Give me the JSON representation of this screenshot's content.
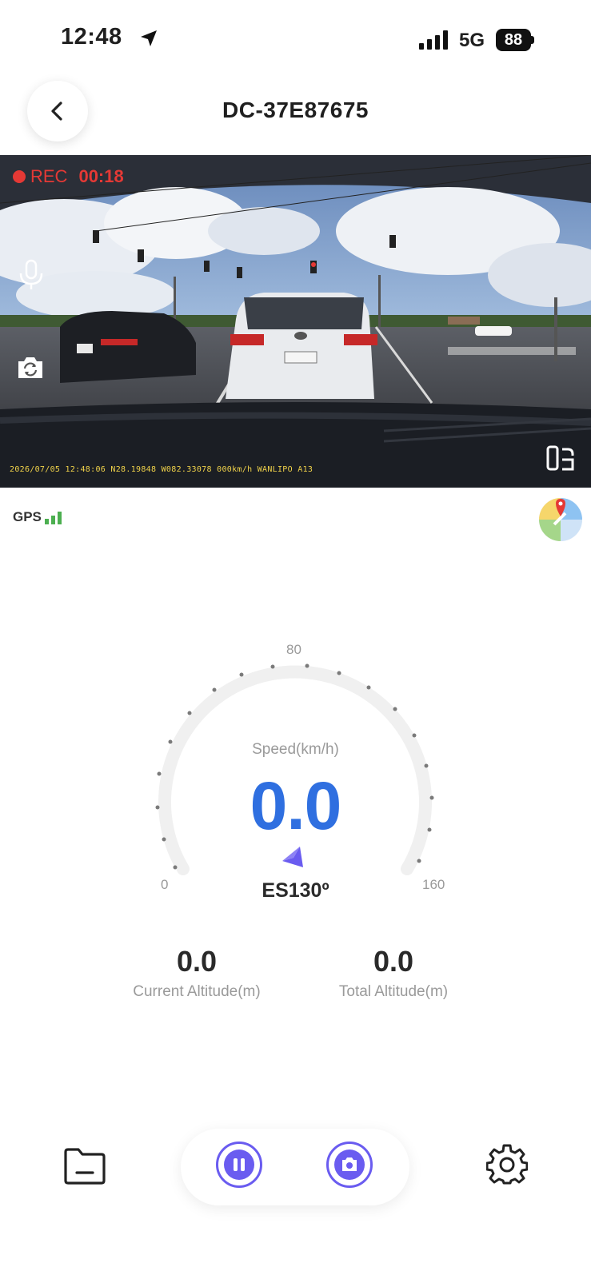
{
  "status_bar": {
    "time": "12:48",
    "network": "5G",
    "battery": "88"
  },
  "header": {
    "title": "DC-37E87675"
  },
  "video": {
    "rec_label": "REC",
    "rec_time": "00:18",
    "osd_text": "2026/07/05 12:48:06  N28.19848 W082.33078 000km/h WANLIPO A13"
  },
  "gps": {
    "label": "GPS"
  },
  "speedometer": {
    "label": "Speed(km/h)",
    "value": "0.0",
    "min_label": "0",
    "mid_label": "80",
    "max_label": "160",
    "heading": "ES130º"
  },
  "altitude": {
    "current_value": "0.0",
    "current_label": "Current Altitude(m)",
    "total_value": "0.0",
    "total_label": "Total Altitude(m)"
  },
  "colors": {
    "accent": "#6a5cf0",
    "speed": "#2f6fe0",
    "rec": "#e53935",
    "osd": "#f1d34a"
  },
  "icons": {
    "back": "chevron-left-icon",
    "mic": "microphone-icon",
    "camera_switch": "camera-switch-icon",
    "fullscreen": "fullscreen-icon",
    "map": "map-pin-icon",
    "folder": "folder-icon",
    "pause": "pause-icon",
    "photo": "camera-icon",
    "settings": "gear-icon"
  }
}
